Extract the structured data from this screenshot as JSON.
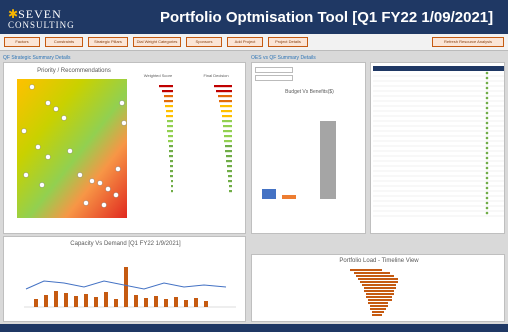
{
  "header": {
    "logo_line1": "SEVEN",
    "logo_line2": "CONSULTING",
    "title": "Portfolio Optmisation Tool [Q1 FY22 1/09/2021]"
  },
  "toolbar": {
    "buttons": [
      "Factors",
      "Constraints",
      "Strategic Pillars",
      "Dial Weight Categories",
      "Sponsors",
      "Add Project",
      "Project Details"
    ],
    "refresh": "Refresh Resource Analysis"
  },
  "sections": {
    "left": "QF Strategic Summary Details",
    "right": "OES vs QF Summary Details"
  },
  "scatter": {
    "title": "Priority / Recommendations"
  },
  "bars": {
    "weighted_title": "Weighted Score",
    "final_title": "Final Decision"
  },
  "budget": {
    "title": "Budget Vs Benefits($)"
  },
  "capacity": {
    "title": "Capacity Vs Demand [Q1 FY22 1/9/2021]"
  },
  "timeline": {
    "title": "Portfolio Load - Timeline View"
  },
  "colors": {
    "navy": "#1f3864",
    "orange": "#c55a11",
    "blue": "#4472c4",
    "green": "#70ad47",
    "yellow": "#ffc000",
    "red": "#c00000"
  }
}
